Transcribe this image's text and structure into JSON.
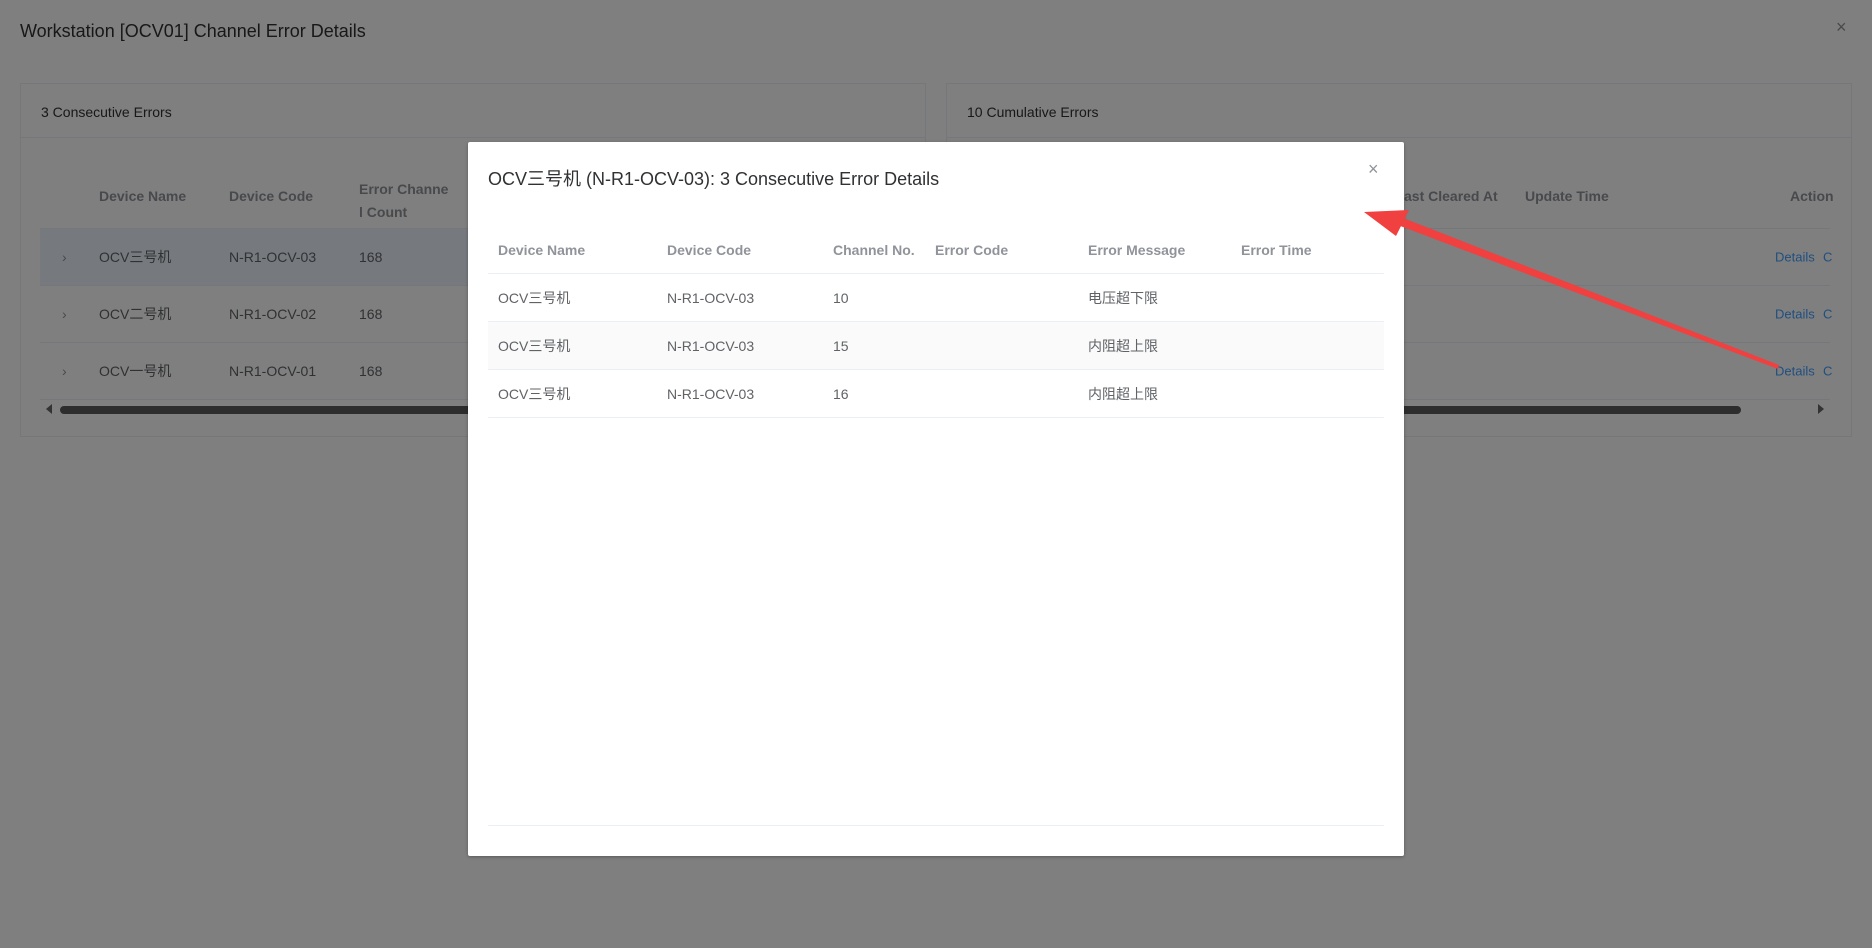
{
  "page": {
    "title": "Workstation [OCV01] Channel Error Details",
    "close_glyph": "×"
  },
  "left_card": {
    "header": "3 Consecutive Errors",
    "columns": [
      "Device Name",
      "Device Code",
      "Error Channe",
      "l Count"
    ],
    "rows": [
      {
        "name": "OCV三号机",
        "code": "N-R1-OCV-03",
        "count": "168"
      },
      {
        "name": "OCV二号机",
        "code": "N-R1-OCV-02",
        "count": "168"
      },
      {
        "name": "OCV一号机",
        "code": "N-R1-OCV-01",
        "count": "168"
      }
    ]
  },
  "right_card": {
    "header": "10 Cumulative Errors",
    "columns": [
      "ast Cleared At",
      "Update Time",
      "Action"
    ],
    "row_links": [
      "Details",
      "C",
      "Details",
      "C",
      "Details",
      "C"
    ]
  },
  "dialog": {
    "title": "OCV三号机 (N-R1-OCV-03): 3 Consecutive Error Details",
    "close_glyph": "×",
    "columns": [
      "Device Name",
      "Device Code",
      "Channel No.",
      "Error Code",
      "Error Message",
      "Error Time"
    ],
    "rows": [
      {
        "name": "OCV三号机",
        "code": "N-R1-OCV-03",
        "channel": "10",
        "error_code": "",
        "message": "电压超下限",
        "time": ""
      },
      {
        "name": "OCV三号机",
        "code": "N-R1-OCV-03",
        "channel": "15",
        "error_code": "",
        "message": "内阻超上限",
        "time": ""
      },
      {
        "name": "OCV三号机",
        "code": "N-R1-OCV-03",
        "channel": "16",
        "error_code": "",
        "message": "内阻超上限",
        "time": ""
      }
    ]
  },
  "colors": {
    "overlay": "rgba(0,0,0,0.5)",
    "link": "#409eff",
    "annotation_arrow": "#f04040"
  },
  "icons": {
    "chevron": "chevron-right-icon",
    "close": "close-icon"
  }
}
